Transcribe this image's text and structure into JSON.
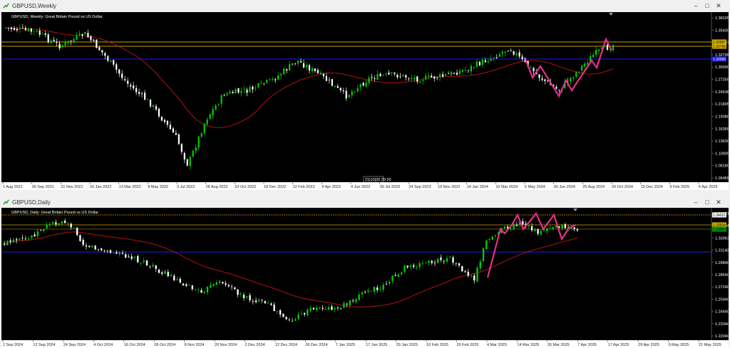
{
  "colors": {
    "bull": "#00d000",
    "bear": "#ffffff",
    "ma": "#c41414",
    "zigzag": "#e62e8c",
    "hline_gold": "#c8a000",
    "hline_blue": "#1a1aff",
    "bg": "#000000",
    "axis_bg": "#ffffff"
  },
  "icons": [
    "chart-window-icon",
    "minimize-icon",
    "maximize-icon",
    "close-icon"
  ],
  "weekly": {
    "title": "GBPUSD,Weekly",
    "symbol_line": "GBPUSD, Weekly: Great Britain Pound vs US Dollar",
    "price_labels": [
      "1.38105",
      "1.35430",
      "1.32997",
      "1.32795",
      "1.30090",
      "1.27255",
      "1.24536",
      "1.21805",
      "1.19080",
      "1.16355",
      "1.13630",
      "1.10905",
      "1.08180",
      "1.05455"
    ],
    "date_labels": [
      "1 Aug 2021",
      "26 Sep 2021",
      "21 Nov 2021",
      "16 Jan 2022",
      "13 Mar 2022",
      "8 May 2022",
      "3 Jul 2022",
      "28 Aug 2022",
      "23 Oct 2022",
      "18 Dec 2022",
      "12 Feb 2023",
      "9 Apr 2023",
      "4 Jun 2023",
      "30 Jul 2023",
      "24 Sep 2023",
      "19 Nov 2023",
      "14 Jan 2024",
      "10 Mar 2024",
      "5 May 2024",
      "30 Jun 2024",
      "25 Aug 2024",
      "20 Oct 2024",
      "15 Dec 2024",
      "9 Feb 2025",
      "6 Apr 2025"
    ],
    "crosshair_date": "21|10|20",
    "crosshair_extra": "20:20"
  },
  "daily": {
    "title": "GBPUSD,Daily",
    "symbol_line": "GBPUSD, Daily: Great Britain Pound vs US Dollar",
    "price_labels": [
      "1.34021",
      "1.33534",
      "1.33063",
      "1.31140",
      "1.29840",
      "1.28540",
      "1.27240",
      "1.25940",
      "1.24640",
      "1.23340",
      "1.22040"
    ],
    "date_labels": [
      "2 Sep 2024",
      "12 Sep 2024",
      "24 Sep 2024",
      "4 Oct 2024",
      "16 Oct 2024",
      "28 Oct 2024",
      "8 Nov 2024",
      "20 Nov 2024",
      "2 Dec 2024",
      "12 Dec 2024",
      "26 Dec 2024",
      "7 Jan 2025",
      "17 Jan 2025",
      "29 Jan 2025",
      "10 Feb 2025",
      "20 Feb 2025",
      "4 Mar 2025",
      "14 Mar 2025",
      "26 Mar 2025",
      "7 Apr 2025",
      "17 Apr 2025",
      "29 Apr 2025",
      "9 May 2025",
      "21 May 2025"
    ]
  }
}
